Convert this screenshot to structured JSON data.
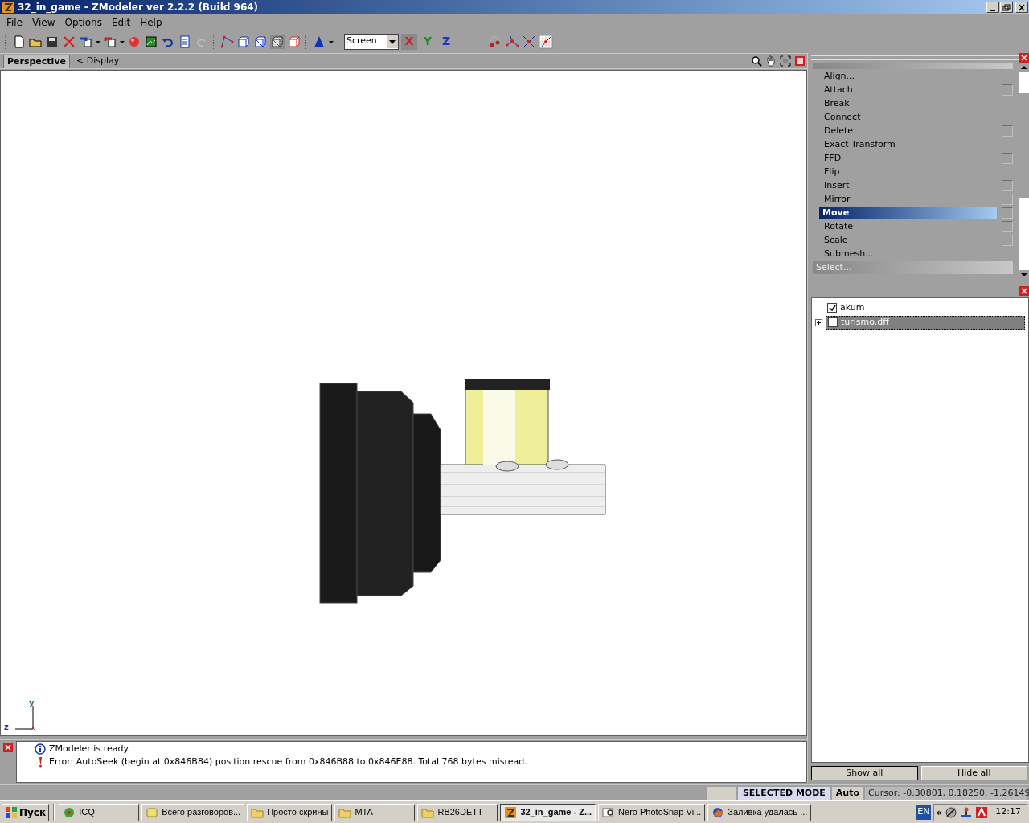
{
  "window": {
    "title": "32_in_game - ZModeler ver 2.2.2 (Build 964)"
  },
  "menu": [
    {
      "label": "File"
    },
    {
      "label": "View"
    },
    {
      "label": "Options"
    },
    {
      "label": "Edit"
    },
    {
      "label": "Help"
    }
  ],
  "toolbar": {
    "coord_dropdown": {
      "value": "Screen"
    },
    "axes": [
      {
        "label": "X",
        "color": "#cc2222"
      },
      {
        "label": "Y",
        "color": "#228822"
      },
      {
        "label": "Z",
        "color": "#2233cc"
      }
    ]
  },
  "viewport": {
    "name": "Perspective",
    "display_link": "< Display",
    "axis_labels": [
      "y",
      "z"
    ]
  },
  "modify_panel": {
    "items": [
      {
        "label": "Align...",
        "kind": "action",
        "selected": false
      },
      {
        "label": "Attach",
        "kind": "toggle",
        "selected": false
      },
      {
        "label": "Break",
        "kind": "action",
        "selected": false
      },
      {
        "label": "Connect",
        "kind": "action",
        "selected": false
      },
      {
        "label": "Delete",
        "kind": "toggle",
        "selected": false
      },
      {
        "label": "Exact Transform",
        "kind": "action",
        "selected": false
      },
      {
        "label": "FFD",
        "kind": "toggle",
        "selected": false
      },
      {
        "label": "Flip",
        "kind": "action",
        "selected": false
      },
      {
        "label": "Insert",
        "kind": "toggle",
        "selected": false
      },
      {
        "label": "Mirror",
        "kind": "toggle",
        "selected": false
      },
      {
        "label": "Move",
        "kind": "toggle",
        "selected": true
      },
      {
        "label": "Rotate",
        "kind": "toggle",
        "selected": false
      },
      {
        "label": "Scale",
        "kind": "toggle",
        "selected": false
      },
      {
        "label": "Submesh...",
        "kind": "action",
        "selected": false
      }
    ],
    "section": "Select..."
  },
  "objects": {
    "tree": [
      {
        "label": "akum",
        "checked": true,
        "selected": false
      },
      {
        "label": "turismo.dff",
        "checked": false,
        "selected": true,
        "expanded": false
      }
    ],
    "buttons": [
      "Show all",
      "Hide all"
    ]
  },
  "log": [
    {
      "kind": "info",
      "text": "ZModeler is ready."
    },
    {
      "kind": "error",
      "text": "Error: AutoSeek (begin at 0x846B84) position rescue  from 0x846B88 to 0x846E88. Total 768 bytes misread."
    }
  ],
  "status_bar": {
    "mode": "SELECTED MODE",
    "snap": "Auto",
    "cursor": "Cursor: -0.30801, 0.18250, -1.26149"
  },
  "taskbar": {
    "start": "Пуск",
    "tasks": [
      {
        "label": "ICQ",
        "kind": "icq",
        "selected": false
      },
      {
        "label": "Всего разговоров...",
        "kind": "chat",
        "selected": false
      },
      {
        "label": "Просто скрины",
        "kind": "folder",
        "selected": false
      },
      {
        "label": "MTA",
        "kind": "folder",
        "selected": false
      },
      {
        "label": "RB26DETT",
        "kind": "folder",
        "selected": false
      },
      {
        "label": "32_in_game - Z...",
        "kind": "zmodeler",
        "selected": true
      },
      {
        "label": "Nero PhotoSnap Vi...",
        "kind": "viewer",
        "selected": false
      },
      {
        "label": "Заливка удалась ...",
        "kind": "browser",
        "selected": false
      }
    ],
    "language": "EN",
    "tray_expand": "«",
    "clock": "12:17"
  }
}
